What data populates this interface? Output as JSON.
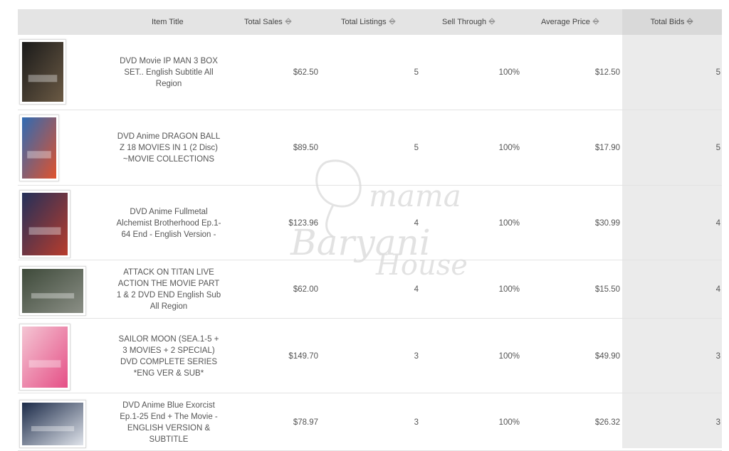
{
  "table": {
    "columns": [
      {
        "key": "item_title",
        "label": "Item Title",
        "sortable": false
      },
      {
        "key": "total_sales",
        "label": "Total Sales",
        "sortable": true
      },
      {
        "key": "total_listings",
        "label": "Total Listings",
        "sortable": true
      },
      {
        "key": "sell_through",
        "label": "Sell Through",
        "sortable": true
      },
      {
        "key": "average_price",
        "label": "Average Price",
        "sortable": true
      },
      {
        "key": "total_bids",
        "label": "Total Bids",
        "sortable": true,
        "active": true
      }
    ],
    "rows": [
      {
        "title": "DVD Movie IP MAN 3 BOX SET.. English Subtitle All Region",
        "total_sales": "$62.50",
        "total_listings": "5",
        "sell_through": "100%",
        "average_price": "$12.50",
        "total_bids": "5",
        "thumb_colors": [
          "#1a1a1a",
          "#6b5a44"
        ]
      },
      {
        "title": "DVD Anime DRAGON BALL Z 18 MOVIES IN 1 (2 Disc) ~MOVIE COLLECTIONS",
        "total_sales": "$89.50",
        "total_listings": "5",
        "sell_through": "100%",
        "average_price": "$17.90",
        "total_bids": "5",
        "thumb_colors": [
          "#2f6bb3",
          "#e0522d"
        ]
      },
      {
        "title": "DVD Anime Fullmetal Alchemist Brotherhood Ep.1-64 End - English Version -",
        "total_sales": "$123.96",
        "total_listings": "4",
        "sell_through": "100%",
        "average_price": "$30.99",
        "total_bids": "4",
        "thumb_colors": [
          "#23305a",
          "#b83c2c"
        ]
      },
      {
        "title": "ATTACK ON TITAN LIVE ACTION THE MOVIE PART 1 & 2 DVD END English Sub All Region",
        "total_sales": "$62.00",
        "total_listings": "4",
        "sell_through": "100%",
        "average_price": "$15.50",
        "total_bids": "4",
        "thumb_colors": [
          "#3e4a3a",
          "#8b8f86"
        ]
      },
      {
        "title": "SAILOR MOON (SEA.1-5 + 3 MOVIES + 2 SPECIAL) DVD COMPLETE SERIES *ENG VER & SUB*",
        "total_sales": "$149.70",
        "total_listings": "3",
        "sell_through": "100%",
        "average_price": "$49.90",
        "total_bids": "3",
        "thumb_colors": [
          "#f4c6d4",
          "#e54f86"
        ]
      },
      {
        "title": "DVD Anime Blue Exorcist Ep.1-25 End + The Movie - ENGLISH VERSION & SUBTITLE",
        "total_sales": "$78.97",
        "total_listings": "3",
        "sell_through": "100%",
        "average_price": "$26.32",
        "total_bids": "3",
        "thumb_colors": [
          "#1b2a48",
          "#dfe3ea"
        ]
      }
    ]
  },
  "watermark": {
    "line1": "mama",
    "line2": "Baryani",
    "line3": "House",
    "color": "#d8d8d8"
  },
  "colors": {
    "header_bg": "#e4e4e4",
    "sorted_column_bg": "#ebebeb",
    "row_border": "#e3e3e3",
    "text": "#555555"
  }
}
